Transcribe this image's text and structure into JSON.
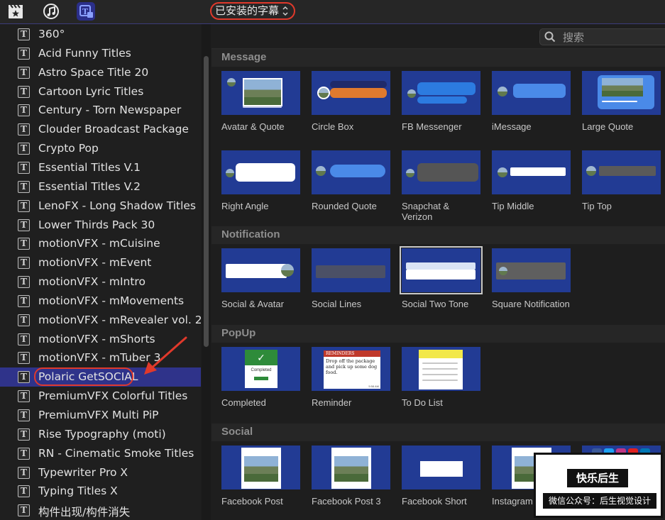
{
  "toolbar": {
    "library_popup": "已安装的字幕",
    "icons": [
      "clapperboard-icon",
      "music-icon",
      "titles-icon"
    ]
  },
  "sidebar": {
    "items": [
      {
        "label": "360°"
      },
      {
        "label": "Acid Funny Titles"
      },
      {
        "label": "Astro Space Title 20"
      },
      {
        "label": "Cartoon Lyric Titles"
      },
      {
        "label": "Century - Torn Newspaper"
      },
      {
        "label": "Clouder Broadcast Package"
      },
      {
        "label": "Crypto Pop"
      },
      {
        "label": "Essential Titles V.1"
      },
      {
        "label": "Essential Titles V.2"
      },
      {
        "label": "LenoFX - Long Shadow Titles"
      },
      {
        "label": "Lower Thirds Pack 30"
      },
      {
        "label": "motionVFX - mCuisine"
      },
      {
        "label": "motionVFX - mEvent"
      },
      {
        "label": "motionVFX - mIntro"
      },
      {
        "label": "motionVFX - mMovements"
      },
      {
        "label": "motionVFX - mRevealer vol. 2"
      },
      {
        "label": "motionVFX - mShorts"
      },
      {
        "label": "motionVFX - mTuber 3"
      },
      {
        "label": "Polaric GetSOCIAL",
        "selected": true
      },
      {
        "label": "PremiumVFX Colorful Titles"
      },
      {
        "label": "PremiumVFX Multi PiP"
      },
      {
        "label": "Rise Typography (moti)"
      },
      {
        "label": "RN - Cinematic Smoke Titles"
      },
      {
        "label": "Typewriter Pro X"
      },
      {
        "label": "Typing Titles X"
      },
      {
        "label": "构件出现/构件消失"
      }
    ]
  },
  "search": {
    "placeholder": "搜索"
  },
  "sections": [
    {
      "title": "Message",
      "tiles": [
        {
          "label": "Avatar & Quote"
        },
        {
          "label": "Circle Box"
        },
        {
          "label": "FB Messenger"
        },
        {
          "label": "iMessage"
        },
        {
          "label": "Large Quote"
        },
        {
          "label": "Right Angle"
        },
        {
          "label": "Rounded Quote"
        },
        {
          "label": "Snapchat & Verizon"
        },
        {
          "label": "Tip Middle"
        },
        {
          "label": "Tip Top"
        }
      ]
    },
    {
      "title": "Notification",
      "tiles": [
        {
          "label": "Social & Avatar"
        },
        {
          "label": "Social Lines"
        },
        {
          "label": "Social Two Tone",
          "selected": true
        },
        {
          "label": "Square Notification"
        }
      ]
    },
    {
      "title": "PopUp",
      "tiles": [
        {
          "label": "Completed"
        },
        {
          "label": "Reminder"
        },
        {
          "label": "To Do List"
        }
      ]
    },
    {
      "title": "Social",
      "tiles": [
        {
          "label": "Facebook Post"
        },
        {
          "label": "Facebook Post 3"
        },
        {
          "label": "Facebook Short"
        },
        {
          "label": "Instagram P"
        },
        {
          "label": ""
        }
      ]
    }
  ],
  "thumb_text": {
    "completed": "Completed",
    "reminder_header": "REMINDERS",
    "reminder_body": "Drop off the package and pick up some dog food.",
    "reminder_time": "5:58 AM"
  },
  "watermark": {
    "title": "快乐后生",
    "subtitle": "微信公众号：后生视觉设计"
  },
  "colors": {
    "accent_selection": "#2f338a",
    "thumb_bg": "#223b94",
    "annotation_red": "#e0392b"
  }
}
